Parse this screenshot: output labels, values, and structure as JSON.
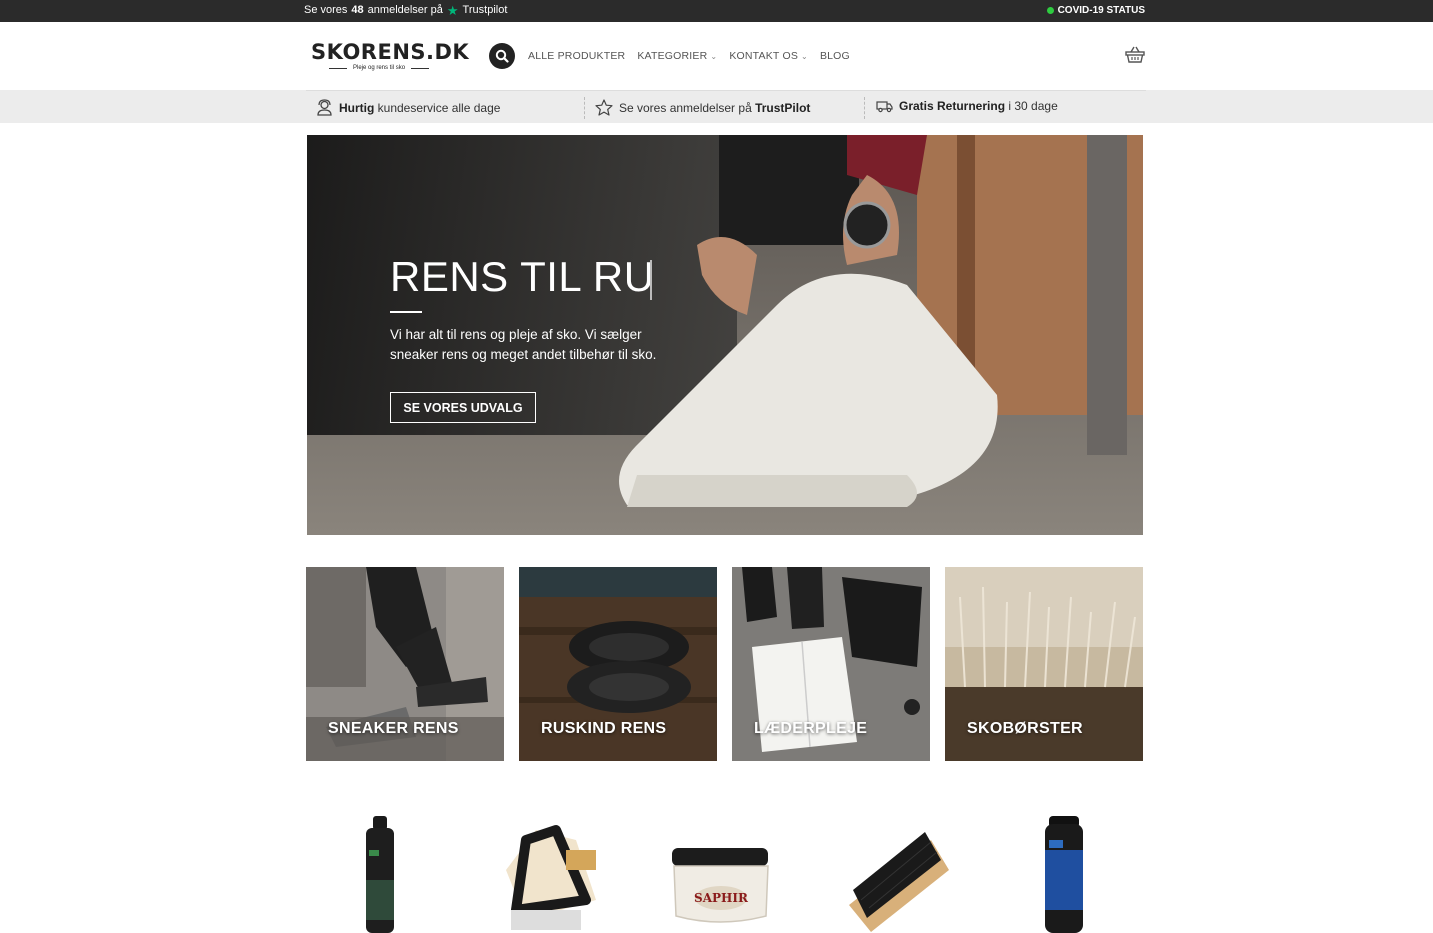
{
  "topbar": {
    "reviews_prefix": "Se vores",
    "reviews_count": "48",
    "reviews_suffix": "anmeldelser på",
    "trustpilot": "Trustpilot",
    "covid": "COVID-19 STATUS"
  },
  "header": {
    "brand": "SKORENS.DK",
    "tagline": "Pleje og rens til sko",
    "nav": [
      {
        "label": "ALLE PRODUKTER",
        "has_dropdown": false
      },
      {
        "label": "KATEGORIER",
        "has_dropdown": true
      },
      {
        "label": "KONTAKT OS",
        "has_dropdown": true
      },
      {
        "label": "BLOG",
        "has_dropdown": false
      }
    ]
  },
  "usp": [
    {
      "bold": "Hurtig",
      "text": " kundeservice alle dage",
      "icon": "support-agent-icon"
    },
    {
      "bold": "",
      "text": "Se vores anmeldelser på ",
      "bold_after": "TrustPilot",
      "icon": "star-outline-icon"
    },
    {
      "bold": "Gratis Returnering",
      "text": " i 30 dage",
      "icon": "delivery-truck-icon"
    }
  ],
  "hero": {
    "title": "RENS TIL RU",
    "text": "Vi har alt til rens og pleje af sko. Vi sælger sneaker rens og meget andet tilbehør til sko.",
    "cta": "SE VORES UDVALG"
  },
  "categories": [
    {
      "label": "SNEAKER RENS"
    },
    {
      "label": "RUSKIND RENS"
    },
    {
      "label": "LÆDERPLEJE"
    },
    {
      "label": "SKOBØRSTER"
    }
  ],
  "colors": {
    "topbar_bg": "#2b2b2b",
    "usp_bg": "#ececec",
    "trustpilot_green": "#00b67a",
    "status_green": "#2ecc40"
  }
}
